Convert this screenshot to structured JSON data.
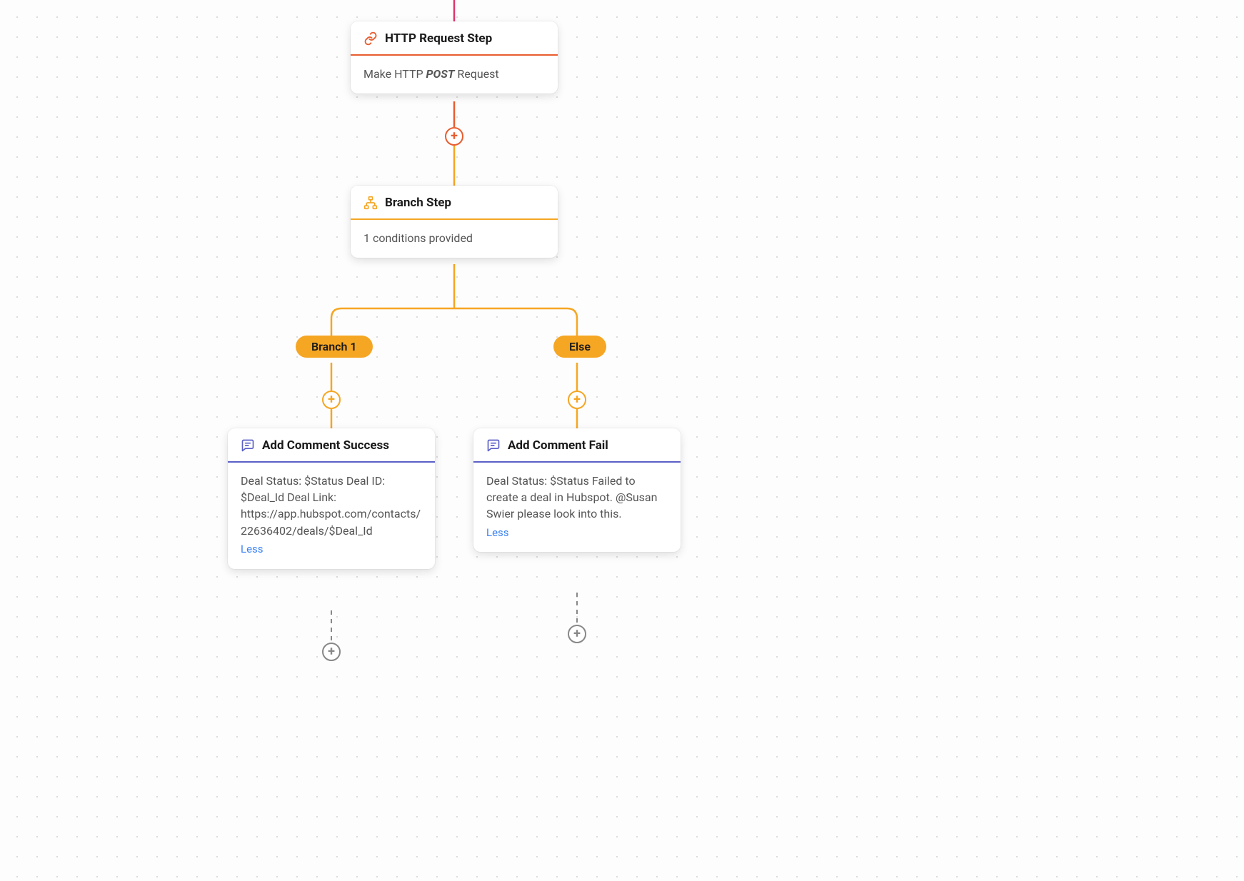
{
  "http_step": {
    "title": "HTTP Request Step",
    "body_prefix": "Make HTTP ",
    "body_method": "POST",
    "body_suffix": " Request"
  },
  "branch_step": {
    "title": "Branch Step",
    "body": "1 conditions provided"
  },
  "branch_pills": {
    "left": "Branch 1",
    "right": "Else"
  },
  "success_step": {
    "title": "Add Comment Success",
    "body": "Deal Status: $Status Deal ID: $Deal_Id Deal Link: https://app.hubspot.com/contacts/22636402/deals/$Deal_Id",
    "less": "Less"
  },
  "fail_step": {
    "title": "Add Comment Fail",
    "body": "Deal Status: $Status Failed to create a deal in Hubspot. @Susan Swier please look into this.",
    "less": "Less"
  }
}
